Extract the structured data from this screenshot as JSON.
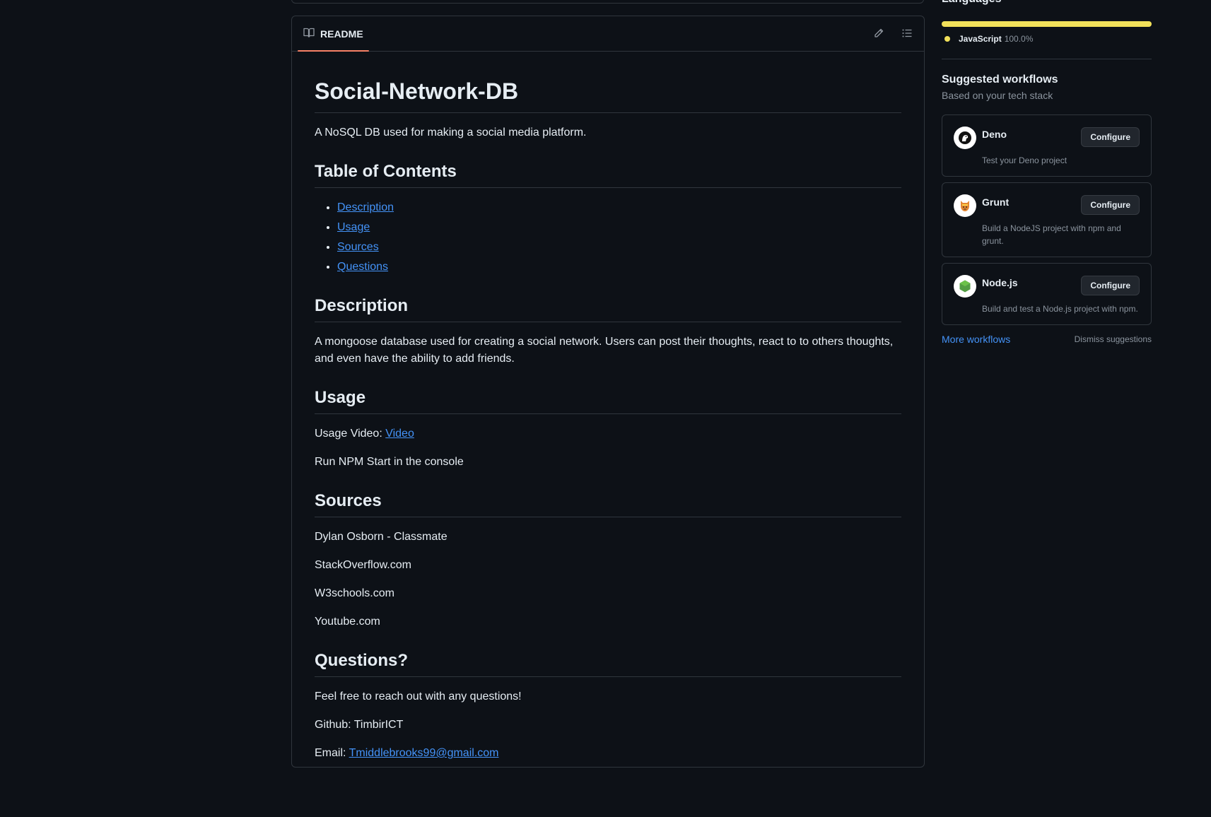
{
  "readme": {
    "tab_label": "README",
    "title": "Social-Network-DB",
    "intro": "A NoSQL DB used for making a social media platform.",
    "toc_heading": "Table of Contents",
    "toc": [
      "Description",
      "Usage",
      "Sources",
      "Questions"
    ],
    "description_heading": "Description",
    "description_text": "A mongoose database used for creating a social network. Users can post their thoughts, react to to others thoughts, and even have the ability to add friends.",
    "usage_heading": "Usage",
    "usage_video_label": "Usage Video: ",
    "usage_video_link": "Video",
    "usage_run": "Run NPM Start in the console",
    "sources_heading": "Sources",
    "sources": [
      "Dylan Osborn - Classmate",
      "StackOverflow.com",
      "W3schools.com",
      "Youtube.com"
    ],
    "questions_heading": "Questions?",
    "questions_text": "Feel free to reach out with any questions!",
    "github_line": "Github: TimbirICT",
    "email_label": "Email: ",
    "email_link": "Tmiddlebrooks99@gmail.com"
  },
  "sidebar": {
    "languages_title": "Languages",
    "languages": [
      {
        "name": "JavaScript",
        "percent": "100.0%",
        "color": "#f1e05a",
        "fraction": 1.0
      }
    ],
    "suggested_title": "Suggested workflows",
    "suggested_sub": "Based on your tech stack",
    "workflows": [
      {
        "name": "Deno",
        "description": "Test your Deno project",
        "button": "Configure",
        "icon": "deno-icon"
      },
      {
        "name": "Grunt",
        "description": "Build a NodeJS project with npm and grunt.",
        "button": "Configure",
        "icon": "grunt-icon"
      },
      {
        "name": "Node.js",
        "description": "Build and test a Node.js project with npm.",
        "button": "Configure",
        "icon": "nodejs-icon"
      }
    ],
    "more_workflows": "More workflows",
    "dismiss": "Dismiss suggestions"
  }
}
